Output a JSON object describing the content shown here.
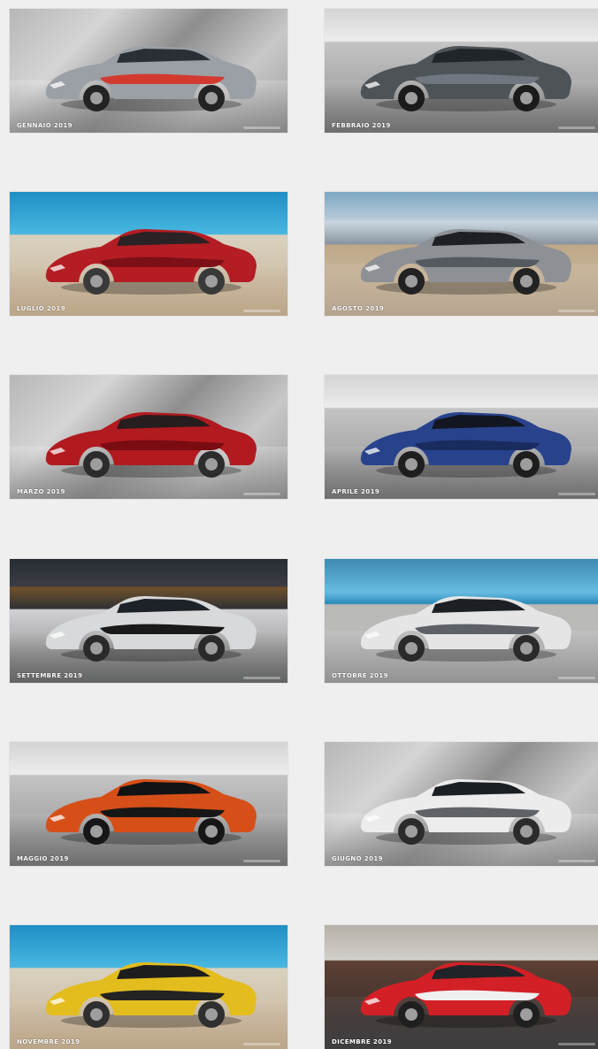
{
  "cards": [
    {
      "caption": "GENNAIO 2019",
      "theme": "studio",
      "body_color": "#9aa0a6",
      "accent_color": "#d33a2f",
      "window_color": "#2a2f36",
      "wheel_color": "#232323"
    },
    {
      "caption": "FEBBRAIO 2019",
      "theme": "showroom",
      "body_color": "#4e5358",
      "accent_color": "#707780",
      "window_color": "#20252a",
      "wheel_color": "#1b1b1b"
    },
    {
      "caption": "LUGLIO 2019",
      "theme": "beach",
      "body_color": "#b31d23",
      "accent_color": "#7c1016",
      "window_color": "#2a2224",
      "wheel_color": "#393939"
    },
    {
      "caption": "AGOSTO 2019",
      "theme": "city",
      "body_color": "#8d9095",
      "accent_color": "#555a61",
      "window_color": "#1d2126",
      "wheel_color": "#222222"
    },
    {
      "caption": "MARZO 2019",
      "theme": "studio",
      "body_color": "#b11a1f",
      "accent_color": "#7a0b10",
      "window_color": "#251d1e",
      "wheel_color": "#2c2c2c"
    },
    {
      "caption": "APRILE 2019",
      "theme": "showroom",
      "body_color": "#28428c",
      "accent_color": "#1a2b5e",
      "window_color": "#121621",
      "wheel_color": "#1e1e1e"
    },
    {
      "caption": "SETTEMBRE 2019",
      "theme": "night",
      "body_color": "#d8d9da",
      "accent_color": "#1a1a1a",
      "window_color": "#1d2228",
      "wheel_color": "#2a2a2a"
    },
    {
      "caption": "OTTOBRE 2019",
      "theme": "sea",
      "body_color": "#e5e5e5",
      "accent_color": "#5d6167",
      "window_color": "#1c2024",
      "wheel_color": "#2a2a2a"
    },
    {
      "caption": "MAGGIO 2019",
      "theme": "showroom",
      "body_color": "#d64f19",
      "accent_color": "#171717",
      "window_color": "#111315",
      "wheel_color": "#161616"
    },
    {
      "caption": "GIUGNO 2019",
      "theme": "studio",
      "body_color": "#ececec",
      "accent_color": "#5f6368",
      "window_color": "#1a1f24",
      "wheel_color": "#2b2b2b"
    },
    {
      "caption": "NOVEMBRE 2019",
      "theme": "beach",
      "body_color": "#e3bd1e",
      "accent_color": "#232323",
      "window_color": "#1d1d1d",
      "wheel_color": "#2f2f2f"
    },
    {
      "caption": "DICEMBRE 2019",
      "theme": "red-dock",
      "body_color": "#d32026",
      "accent_color": "#f0f0f0",
      "window_color": "#202327",
      "wheel_color": "#1f1f1f"
    }
  ]
}
